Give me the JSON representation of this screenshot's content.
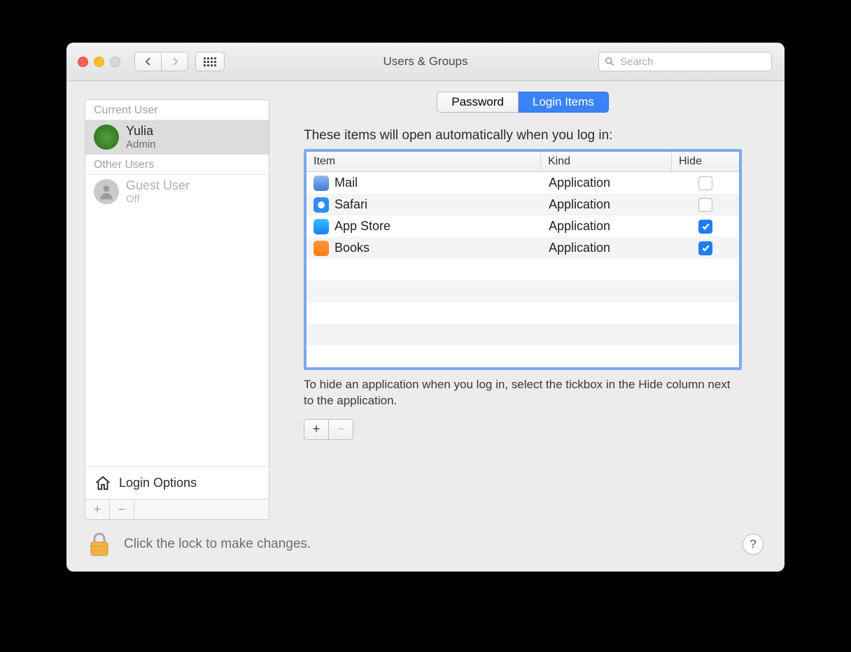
{
  "window": {
    "title": "Users & Groups",
    "search_placeholder": "Search"
  },
  "sidebar": {
    "current_header": "Current User",
    "other_header": "Other Users",
    "current": {
      "name": "Yulia",
      "role": "Admin"
    },
    "guest": {
      "name": "Guest User",
      "status": "Off"
    },
    "login_options": "Login Options",
    "add": "+",
    "remove": "−"
  },
  "tabs": {
    "password": "Password",
    "login_items": "Login Items",
    "active": "login_items"
  },
  "panel": {
    "description": "These items will open automatically when you log in:",
    "columns": {
      "item": "Item",
      "kind": "Kind",
      "hide": "Hide"
    },
    "items": [
      {
        "name": "Mail",
        "kind": "Application",
        "hide": false,
        "icon": "mail"
      },
      {
        "name": "Safari",
        "kind": "Application",
        "hide": false,
        "icon": "safari"
      },
      {
        "name": "App Store",
        "kind": "Application",
        "hide": true,
        "icon": "appstore"
      },
      {
        "name": "Books",
        "kind": "Application",
        "hide": true,
        "icon": "books"
      }
    ],
    "hint": "To hide an application when you log in, select the tickbox in the Hide column next to the application.",
    "add": "+",
    "remove": "−"
  },
  "footer": {
    "lock_msg": "Click the lock to make changes.",
    "help": "?"
  }
}
